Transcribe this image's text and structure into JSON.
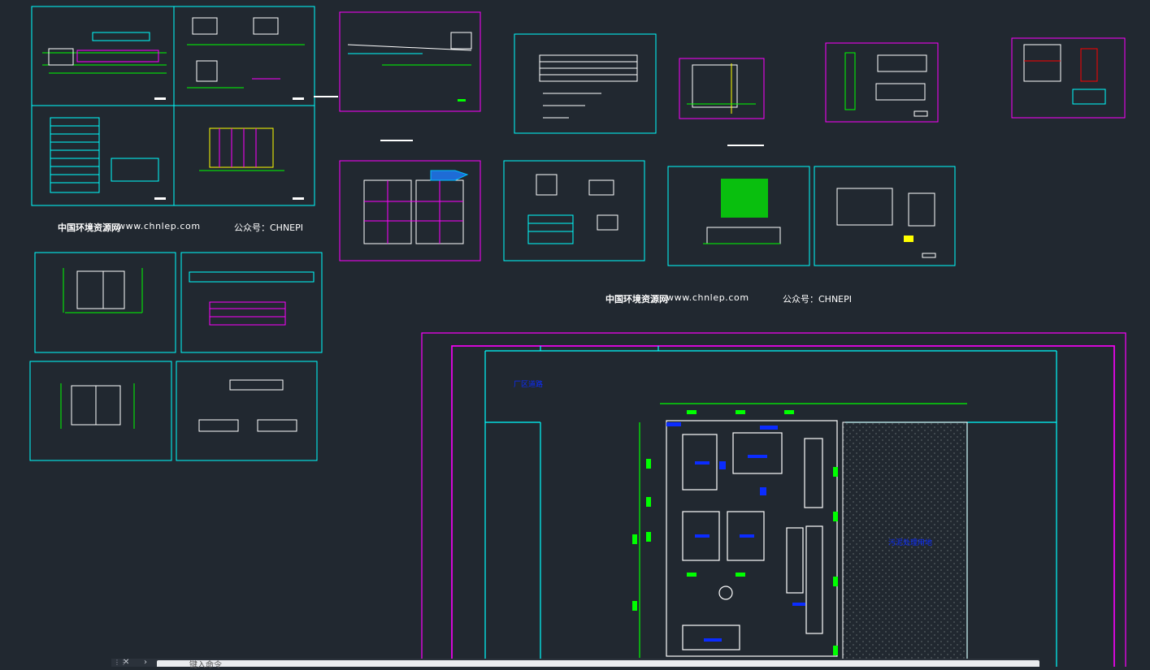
{
  "canvas": {
    "background": "#212830",
    "frame_color": "#00ffff",
    "sheet_border_color": "#ff00ff",
    "accent_colors": [
      "#00ff00",
      "#0000ff",
      "#ffff00",
      "#ff00ff",
      "#00ffff"
    ]
  },
  "watermarks": [
    {
      "site": "中国环境资源网",
      "url": "www.chnlep.com",
      "wechat": "公众号：CHNEPI"
    },
    {
      "site": "中国环境资源网",
      "url": "www.chnlep.com",
      "wechat": "公众号：CHNEPI"
    }
  ],
  "site_plan": {
    "hatched_area_label": "污泥处理用地",
    "corner_label": "厂区道路"
  },
  "command_line": {
    "prompt_icon": "chevron-right-icon",
    "placeholder": "键入命令"
  }
}
